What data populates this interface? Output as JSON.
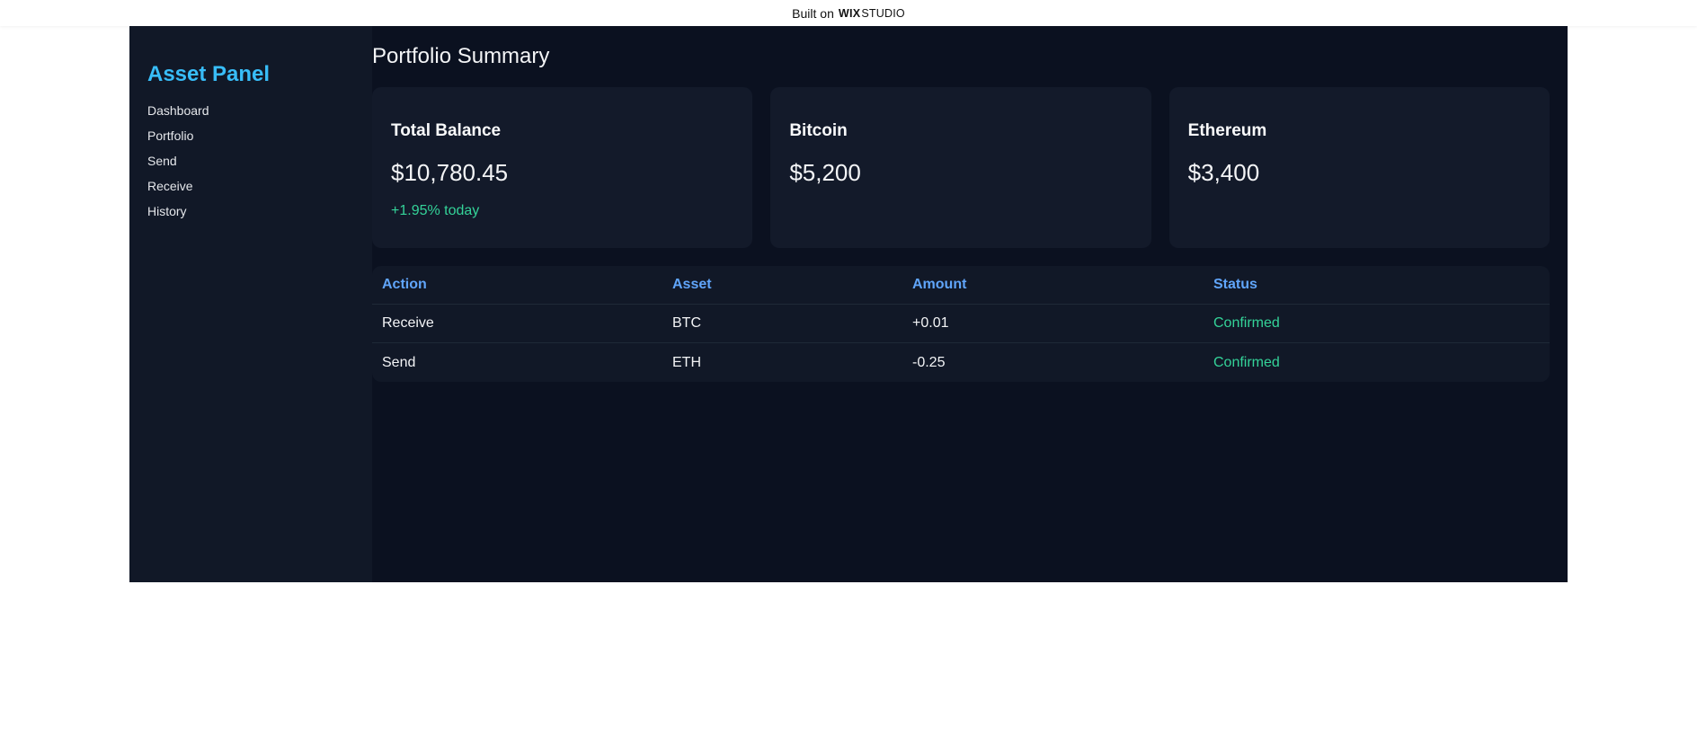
{
  "topbar": {
    "prefix": "Built on",
    "brand_bold": "WIX",
    "brand_light": "STUDIO"
  },
  "sidebar": {
    "title": "Asset Panel",
    "items": [
      {
        "label": "Dashboard"
      },
      {
        "label": "Portfolio"
      },
      {
        "label": "Send"
      },
      {
        "label": "Receive"
      },
      {
        "label": "History"
      }
    ]
  },
  "main": {
    "title": "Portfolio Summary",
    "cards": [
      {
        "title": "Total Balance",
        "value": "$10,780.45",
        "change": "+1.95% today"
      },
      {
        "title": "Bitcoin",
        "value": "$5,200"
      },
      {
        "title": "Ethereum",
        "value": "$3,400"
      }
    ],
    "table": {
      "headers": [
        "Action",
        "Asset",
        "Amount",
        "Status"
      ],
      "rows": [
        [
          "Receive",
          "BTC",
          "+0.01",
          "Confirmed"
        ],
        [
          "Send",
          "ETH",
          "-0.25",
          "Confirmed"
        ]
      ]
    }
  },
  "colors": {
    "accent": "#38bdf8",
    "header_text": "#60a5fa",
    "positive": "#34d399",
    "background": "#0b1120",
    "sidebar_bg": "#111827"
  }
}
